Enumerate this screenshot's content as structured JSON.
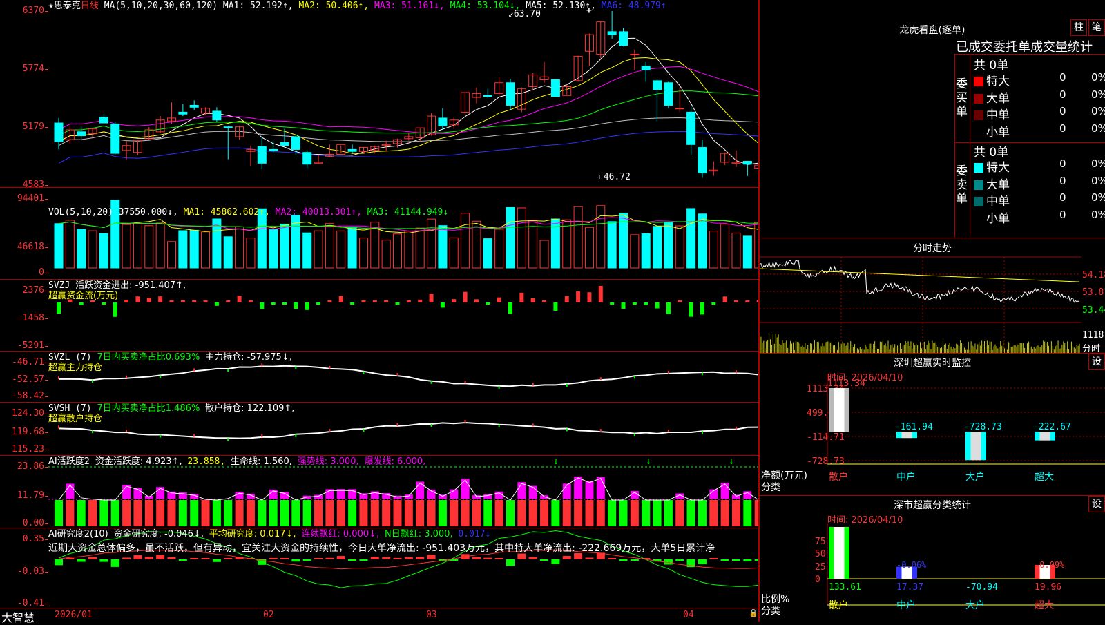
{
  "main": {
    "symbol_star": "★",
    "stock_name": "思泰克",
    "period": "日线",
    "ma_header": "MA(5,10,20,30,60,120)",
    "ma1": "MA1: 52.192↑,",
    "ma2": "MA2: 50.406↑,",
    "ma3": "MA3: 51.161↓,",
    "ma4": "MA4: 53.104↓,",
    "ma5": "MA5: 52.130↑,",
    "ma6": "MA6: 48.979↑",
    "high_mark": "63.70",
    "low_mark": "←46.72",
    "y_labels": [
      "6370",
      "5774",
      "5179",
      "4583"
    ]
  },
  "vol": {
    "header": "VOL(5,10,20)",
    "value": "37550.000↓,",
    "ma1": "MA1: 45862.602↑,",
    "ma2": "MA2: 40013.301↑,",
    "ma3": "MA3: 41144.949↓",
    "y_labels": [
      "94401",
      "46618",
      "0"
    ]
  },
  "svzj": {
    "header": "SVZJ",
    "line1": "活跃资金进出: -951.407↑,",
    "line2": "超赢资金流(万元)",
    "y_labels": [
      "2376",
      "-1458",
      "-5291"
    ]
  },
  "svzl": {
    "header": "SVZL (7)",
    "pct": "7日内买卖净占比0.693%",
    "main": "主力持仓: -57.975↓,",
    "line2": "超赢主力持仓",
    "y_labels": [
      "-46.71",
      "-52.57",
      "-58.42"
    ]
  },
  "svsh": {
    "header": "SVSH (7)",
    "pct": "7日内买卖净占比1.486%",
    "retail": "散户持仓: 122.109↑,",
    "line2": "超赢散户持仓",
    "y_labels": [
      "124.30",
      "119.68",
      "115.23"
    ]
  },
  "ai1": {
    "header": "AI活跃度2",
    "active": "资金活跃度: 4.923↑,",
    "v2": "23.858,",
    "life": "生命线: 1.560,",
    "strong": "强势线: 3.000,",
    "burst": "爆发线: 6.000,",
    "y_labels": [
      "23.86",
      "11.79",
      "0.00"
    ]
  },
  "ai2": {
    "header": "AI研究度2(10)",
    "research": "资金研究度: -0.046↓,",
    "avg": "平均研究度: 0.017↓,",
    "lianxu": "连续飘红: 0.000↓,",
    "nred": "N日飘红: 3.000,",
    "v5": "0.017↓",
    "comment": "近期大资金总体偏多，虽不活跃，但有异动，宜关注大资金的持续性，今日大单净流出: -951.403万元，其中特大单净流出: -222.669万元，大单5日累计净",
    "y_labels": [
      "0.35",
      "-0.03",
      "-0.41"
    ]
  },
  "xaxis": {
    "brand": "大智慧",
    "labels": [
      "2026/01",
      "02",
      "03",
      "04"
    ]
  },
  "lhb": {
    "title": "龙虎看盘(逐单)",
    "btn1": "柱",
    "btn2": "笔",
    "subtitle": "已成交委托单成交量统计",
    "buy": {
      "side_label": "委买单",
      "total": "共 0单",
      "rows": [
        {
          "label": "特大",
          "value": "0",
          "pct": "0%",
          "color": "#ff0000"
        },
        {
          "label": "大单",
          "value": "0",
          "pct": "0%",
          "color": "#9a0000"
        },
        {
          "label": "中单",
          "value": "0",
          "pct": "0%",
          "color": "#6a0000"
        },
        {
          "label": "小单",
          "value": "0",
          "pct": "0%",
          "color": ""
        }
      ]
    },
    "sell": {
      "side_label": "委卖单",
      "total": "共 0单",
      "rows": [
        {
          "label": "特大",
          "value": "0",
          "pct": "0%",
          "color": "#00ffff"
        },
        {
          "label": "大单",
          "value": "0",
          "pct": "0%",
          "color": "#008a8a"
        },
        {
          "label": "中单",
          "value": "0",
          "pct": "0%",
          "color": "#006b6b"
        },
        {
          "label": "小单",
          "value": "0",
          "pct": "0%",
          "color": ""
        }
      ]
    }
  },
  "intraday": {
    "title": "分时走势",
    "price_labels": [
      "54.18",
      "53.81",
      "53.44"
    ],
    "vol_label": "1118",
    "vol_unit": "分时"
  },
  "monitor": {
    "title": "深圳超赢实时监控",
    "settings": "设",
    "time": "时间: 2026/04/10",
    "y_labels": [
      "1113.34",
      "499.32",
      "-114.71",
      "-728.73"
    ],
    "unit_label": "净额(万元)",
    "cat_label": "分类",
    "bars": [
      {
        "label": "散户",
        "value": 1113.34,
        "text": "1113.34"
      },
      {
        "label": "中户",
        "value": -161.94,
        "text": "-161.94"
      },
      {
        "label": "大户",
        "value": -728.73,
        "text": "-728.73"
      },
      {
        "label": "超大",
        "value": -222.67,
        "text": "-222.67"
      }
    ]
  },
  "classify": {
    "title": "深市超赢分类统计",
    "settings": "设",
    "time": "时间: 2026/04/10",
    "y_labels": [
      "75",
      "50",
      "25",
      "0"
    ],
    "unit_label": "比例%",
    "cat_label": "分类",
    "bars": [
      {
        "label": "散户",
        "value": 133.61,
        "text": "133.61",
        "top_text": ""
      },
      {
        "label": "中户",
        "value": 17.37,
        "text": "17.37",
        "top_text": "-0.06%"
      },
      {
        "label": "大户",
        "value": -70.94,
        "text": "-70.94",
        "top_text": ""
      },
      {
        "label": "超大",
        "value": 19.96,
        "text": "19.96",
        "top_text": "-0.09%"
      }
    ]
  },
  "colors": {
    "up": "#ff3333",
    "down": "#00ffff",
    "grid": "#aa0000",
    "vol_down": "#00ffff"
  },
  "chart_data": {
    "type": "candlestick",
    "x_labels": [
      "2026/01",
      "02",
      "03",
      "04"
    ],
    "ylim": [
      45.83,
      63.7
    ],
    "ma_series_names": [
      "MA1",
      "MA2",
      "MA3",
      "MA4",
      "MA5",
      "MA6"
    ],
    "ohlc": [
      [
        52.3,
        52.8,
        49.6,
        50.4
      ],
      [
        50.6,
        52.0,
        50.2,
        51.6
      ],
      [
        51.4,
        51.9,
        50.7,
        51.0
      ],
      [
        51.2,
        51.8,
        50.9,
        51.7
      ],
      [
        52.9,
        53.2,
        52.3,
        52.3
      ],
      [
        52.2,
        52.4,
        49.1,
        49.2
      ],
      [
        49.5,
        50.5,
        48.6,
        50.0
      ],
      [
        49.3,
        50.5,
        49.0,
        50.5
      ],
      [
        50.7,
        51.9,
        50.6,
        51.6
      ],
      [
        51.4,
        53.0,
        51.3,
        52.6
      ],
      [
        52.5,
        54.4,
        52.2,
        52.8
      ],
      [
        53.4,
        54.2,
        53.0,
        53.2
      ],
      [
        54.1,
        54.6,
        53.6,
        53.9
      ],
      [
        53.3,
        53.9,
        53.1,
        53.8
      ],
      [
        53.5,
        53.9,
        52.4,
        52.6
      ],
      [
        51.9,
        52.0,
        48.6,
        51.8
      ],
      [
        50.9,
        52.0,
        50.6,
        51.9
      ],
      [
        49.4,
        50.0,
        47.9,
        49.6
      ],
      [
        49.9,
        50.8,
        47.6,
        48.2
      ],
      [
        49.6,
        50.4,
        49.3,
        49.5
      ],
      [
        50.3,
        51.7,
        50.0,
        50.0
      ],
      [
        50.9,
        51.1,
        49.0,
        49.6
      ],
      [
        49.3,
        49.5,
        47.7,
        48.1
      ],
      [
        48.2,
        49.1,
        48.2,
        48.3
      ],
      [
        48.9,
        50.1,
        48.8,
        49.1
      ],
      [
        49.1,
        50.0,
        49.2,
        50.1
      ],
      [
        49.6,
        50.1,
        49.2,
        49.4
      ],
      [
        49.4,
        49.8,
        49.2,
        49.8
      ],
      [
        49.5,
        50.0,
        49.2,
        49.9
      ],
      [
        50.0,
        50.5,
        49.4,
        50.1
      ],
      [
        50.2,
        50.7,
        49.8,
        50.6
      ],
      [
        50.7,
        51.3,
        50.5,
        50.9
      ],
      [
        50.8,
        51.8,
        50.4,
        51.8
      ],
      [
        51.1,
        53.3,
        51.0,
        53.0
      ],
      [
        52.8,
        53.8,
        51.6,
        52.0
      ],
      [
        52.1,
        52.9,
        51.7,
        52.6
      ],
      [
        53.4,
        55.4,
        53.1,
        55.4
      ],
      [
        54.9,
        55.9,
        54.3,
        55.3
      ],
      [
        55.1,
        55.8,
        54.8,
        55.0
      ],
      [
        55.3,
        57.0,
        55.1,
        56.4
      ],
      [
        56.4,
        56.8,
        53.6,
        54.1
      ],
      [
        53.7,
        55.9,
        53.4,
        55.8
      ],
      [
        56.0,
        57.4,
        55.6,
        57.2
      ],
      [
        56.7,
        58.5,
        56.4,
        57.0
      ],
      [
        56.7,
        56.4,
        55.0,
        55.0
      ],
      [
        55.1,
        56.2,
        55.2,
        56.0
      ],
      [
        56.6,
        59.1,
        56.5,
        59.1
      ],
      [
        59.6,
        61.4,
        58.1,
        61.3
      ],
      [
        59.3,
        62.6,
        58.9,
        62.6
      ],
      [
        61.6,
        63.7,
        60.9,
        61.3
      ],
      [
        61.6,
        62.0,
        60.1,
        60.2
      ],
      [
        59.3,
        59.8,
        57.7,
        59.3
      ],
      [
        58.1,
        58.5,
        56.5,
        57.7
      ],
      [
        56.6,
        56.7,
        52.5,
        55.7
      ],
      [
        56.4,
        56.5,
        53.8,
        54.1
      ],
      [
        53.8,
        55.9,
        53.4,
        53.8
      ],
      [
        53.4,
        53.9,
        49.0,
        50.1
      ],
      [
        49.8,
        50.6,
        46.7,
        47.2
      ],
      [
        47.4,
        48.4,
        46.9,
        47.5
      ],
      [
        48.3,
        49.3,
        48.0,
        49.2
      ],
      [
        48.2,
        49.5,
        47.8,
        48.3
      ],
      [
        48.4,
        48.4,
        46.9,
        48.1
      ],
      [
        47.7,
        48.9,
        47.0,
        48.0
      ],
      [
        48.8,
        48.7,
        46.7,
        46.7
      ],
      [
        49.3,
        49.8,
        48.9,
        49.0
      ],
      [
        50.0,
        50.4,
        47.7,
        47.7
      ],
      [
        47.5,
        49.8,
        47.7,
        49.8
      ],
      [
        49.6,
        50.6,
        49.1,
        49.1
      ],
      [
        49.6,
        49.8,
        48.1,
        49.6
      ],
      [
        50.1,
        50.6,
        49.6,
        50.3
      ],
      [
        51.4,
        53.8,
        50.5,
        53.6
      ],
      [
        53.6,
        55.1,
        53.8,
        53.6
      ],
      [
        54.0,
        54.1,
        53.3,
        53.0
      ]
    ]
  }
}
